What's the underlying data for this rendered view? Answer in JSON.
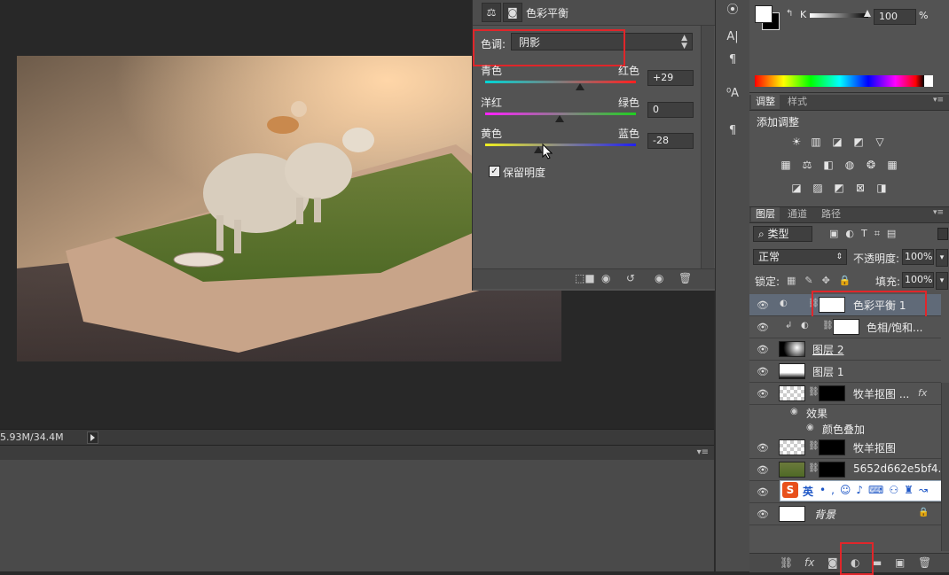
{
  "status": {
    "doc_size": "5.93M/34.4M"
  },
  "properties": {
    "title": "色彩平衡",
    "tone_label": "色调:",
    "tone_value": "阴影",
    "sliders": [
      {
        "left": "青色",
        "right": "红色",
        "value": "+29",
        "position": 0.65
      },
      {
        "left": "洋红",
        "right": "绿色",
        "value": "0",
        "position": 0.5
      },
      {
        "left": "黄色",
        "right": "蓝色",
        "value": "-28",
        "position": 0.36
      }
    ],
    "preserve_luminosity": "保留明度",
    "preserve_checked": true
  },
  "color": {
    "channel": "K",
    "value": "100",
    "unit": "%"
  },
  "adjustments": {
    "tabs": [
      "调整",
      "样式"
    ],
    "add_label": "添加调整"
  },
  "layers": {
    "tabs": [
      "图层",
      "通道",
      "路径"
    ],
    "filter_kind": "类型",
    "blend_mode": "正常",
    "opacity_label": "不透明度:",
    "opacity": "100%",
    "lock_label": "锁定:",
    "fill_label": "填充:",
    "fill": "100%",
    "rows": [
      {
        "name": "色彩平衡 1"
      },
      {
        "name": "色相/饱和..."
      },
      {
        "name": "图层 2"
      },
      {
        "name": "图层 1"
      },
      {
        "name": "牧羊抠图 ..."
      },
      {
        "name": "效果"
      },
      {
        "name": "颜色叠加"
      },
      {
        "name": "牧羊抠图"
      },
      {
        "name": "5652d662e5bf4..."
      },
      {
        "name": ""
      },
      {
        "name": "背景"
      }
    ],
    "ime_label": "英"
  },
  "colors": {
    "highlight": "#e0262a",
    "panel": "#535353"
  }
}
